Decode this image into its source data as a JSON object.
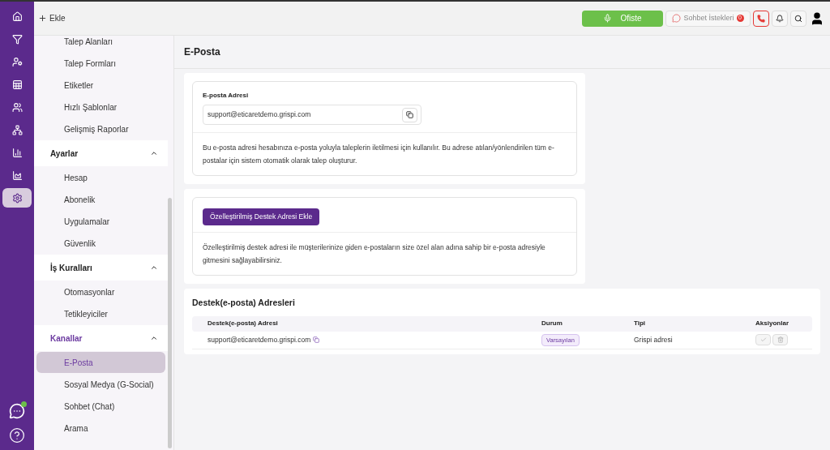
{
  "rail": [
    {
      "kind": "home",
      "selected": false
    },
    {
      "kind": "filter",
      "selected": false
    },
    {
      "kind": "user-filter",
      "selected": false
    },
    {
      "kind": "table-filter",
      "selected": false
    },
    {
      "kind": "users",
      "selected": false
    },
    {
      "kind": "hierarchy",
      "selected": false
    },
    {
      "kind": "bar-chart",
      "selected": false
    },
    {
      "kind": "area-chart",
      "selected": false
    },
    {
      "kind": "settings",
      "selected": true
    }
  ],
  "topbar": {
    "add_label": "Ekle",
    "status_label": "Ofiste",
    "chat_label": "Sohbet İstekleri",
    "chat_count": "0"
  },
  "sidebar": {
    "items": [
      {
        "label": "Talep Alanları",
        "selected": false
      },
      {
        "label": "Talep Formları",
        "selected": false
      },
      {
        "label": "Etiketler",
        "selected": false
      },
      {
        "label": "Hızlı Şablonlar",
        "selected": false
      },
      {
        "label": "Gelişmiş Raporlar",
        "selected": false
      }
    ],
    "groups": [
      {
        "title": "Ayarlar",
        "expanded": true,
        "active": false,
        "items": [
          {
            "label": "Hesap",
            "selected": false
          },
          {
            "label": "Abonelik",
            "selected": false
          },
          {
            "label": "Uygulamalar",
            "selected": false
          },
          {
            "label": "Güvenlik",
            "selected": false
          }
        ]
      },
      {
        "title": "İş Kuralları",
        "expanded": true,
        "active": false,
        "items": [
          {
            "label": "Otomasyonlar",
            "selected": false
          },
          {
            "label": "Tetikleyiciler",
            "selected": false
          }
        ]
      },
      {
        "title": "Kanallar",
        "expanded": true,
        "active": true,
        "items": [
          {
            "label": "E-Posta",
            "selected": true
          },
          {
            "label": "Sosyal Medya (G-Social)",
            "selected": false
          },
          {
            "label": "Sohbet (Chat)",
            "selected": false
          },
          {
            "label": "Arama",
            "selected": false
          }
        ]
      }
    ]
  },
  "page_title": "E-Posta",
  "email_card": {
    "label": "E-posta Adresi",
    "value": "support@eticaretdemo.grispi.com",
    "description": "Bu e-posta adresi hesabınıza e-posta yoluyla taleplerin iletilmesi için kullanılır. Bu adrese atılan/yönlendirilen tüm e-postalar için sistem otomatik olarak talep oluşturur."
  },
  "custom_card": {
    "button": "Özelleştirilmiş Destek Adresi Ekle",
    "description": "Özelleştirilmiş destek adresi ile müşterilerinize giden e-postaların size özel alan adına sahip bir e-posta adresiyle gitmesini sağlayabilirsiniz."
  },
  "addresses": {
    "title": "Destek(e-posta) Adresleri",
    "columns": [
      "Destek(e-posta) Adresi",
      "Durum",
      "Tipi",
      "Aksiyonlar"
    ],
    "rows": [
      {
        "address": "support@eticaretdemo.grispi.com",
        "status": "Varsayılan",
        "type": "Grispi adresi"
      }
    ]
  }
}
